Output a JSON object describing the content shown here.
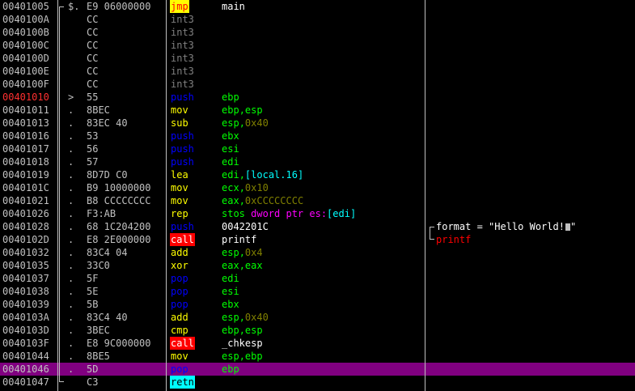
{
  "colors": {
    "background": "#000000",
    "text": "#c0c0c0",
    "white": "#ffffff",
    "mnemonic_default": "#ffff00",
    "int3": "#808080",
    "push_pop": "#0000ff",
    "call_bg": "#ff0000",
    "call_text": "#ffffff",
    "jmp_bg": "#ffff00",
    "jmp_text": "#ff0000",
    "retn_bg": "#00ffff",
    "retn_text": "#000000",
    "register": "#00ff00",
    "number": "#808000",
    "memref": "#00ffff",
    "keyword": "#ff00ff",
    "comment_red": "#ff0000",
    "selection": "#800080",
    "addr_current": "#ff3030"
  },
  "disassembly": [
    {
      "addr": "00401005",
      "mark": "$.",
      "hex": "E9 06000000",
      "mnemonic": "jmp",
      "ops": [
        [
          "main",
          "white"
        ]
      ]
    },
    {
      "addr": "0040100A",
      "mark": "",
      "hex": "CC",
      "mnemonic": "int3",
      "ops": []
    },
    {
      "addr": "0040100B",
      "mark": "",
      "hex": "CC",
      "mnemonic": "int3",
      "ops": []
    },
    {
      "addr": "0040100C",
      "mark": "",
      "hex": "CC",
      "mnemonic": "int3",
      "ops": []
    },
    {
      "addr": "0040100D",
      "mark": "",
      "hex": "CC",
      "mnemonic": "int3",
      "ops": []
    },
    {
      "addr": "0040100E",
      "mark": "",
      "hex": "CC",
      "mnemonic": "int3",
      "ops": []
    },
    {
      "addr": "0040100F",
      "mark": "",
      "hex": "CC",
      "mnemonic": "int3",
      "ops": []
    },
    {
      "addr": "00401010",
      "mark": ">",
      "hex": "55",
      "mnemonic": "push",
      "ops": [
        [
          "ebp",
          "register"
        ]
      ]
    },
    {
      "addr": "00401011",
      "mark": ".",
      "hex": "8BEC",
      "mnemonic": "mov",
      "ops": [
        [
          "ebp",
          "register"
        ],
        [
          ",",
          "register"
        ],
        [
          "esp",
          "register"
        ]
      ]
    },
    {
      "addr": "00401013",
      "mark": ".",
      "hex": "83EC 40",
      "mnemonic": "sub",
      "ops": [
        [
          "esp",
          "register"
        ],
        [
          ",",
          "register"
        ],
        [
          "0x40",
          "number"
        ]
      ]
    },
    {
      "addr": "00401016",
      "mark": ".",
      "hex": "53",
      "mnemonic": "push",
      "ops": [
        [
          "ebx",
          "register"
        ]
      ]
    },
    {
      "addr": "00401017",
      "mark": ".",
      "hex": "56",
      "mnemonic": "push",
      "ops": [
        [
          "esi",
          "register"
        ]
      ]
    },
    {
      "addr": "00401018",
      "mark": ".",
      "hex": "57",
      "mnemonic": "push",
      "ops": [
        [
          "edi",
          "register"
        ]
      ]
    },
    {
      "addr": "00401019",
      "mark": ".",
      "hex": "8D7D C0",
      "mnemonic": "lea",
      "ops": [
        [
          "edi",
          "register"
        ],
        [
          ",",
          "register"
        ],
        [
          "[local.16]",
          "memref"
        ]
      ]
    },
    {
      "addr": "0040101C",
      "mark": ".",
      "hex": "B9 10000000",
      "mnemonic": "mov",
      "ops": [
        [
          "ecx",
          "register"
        ],
        [
          ",",
          "register"
        ],
        [
          "0x10",
          "number"
        ]
      ]
    },
    {
      "addr": "00401021",
      "mark": ".",
      "hex": "B8 CCCCCCCC",
      "mnemonic": "mov",
      "ops": [
        [
          "eax",
          "register"
        ],
        [
          ",",
          "register"
        ],
        [
          "0xCCCCCCCC",
          "number"
        ]
      ]
    },
    {
      "addr": "00401026",
      "mark": ".",
      "hex": "F3:AB",
      "mnemonic": "rep",
      "ops": [
        [
          "stos ",
          "register"
        ],
        [
          "dword ptr es:",
          "keyword"
        ],
        [
          "[edi]",
          "memref"
        ]
      ]
    },
    {
      "addr": "00401028",
      "mark": ".",
      "hex": "68 1C204200",
      "mnemonic": "push",
      "ops": [
        [
          "0042201C",
          "white"
        ]
      ]
    },
    {
      "addr": "0040102D",
      "mark": ".",
      "hex": "E8 2E000000",
      "mnemonic": "call",
      "ops": [
        [
          "printf",
          "white"
        ]
      ]
    },
    {
      "addr": "00401032",
      "mark": ".",
      "hex": "83C4 04",
      "mnemonic": "add",
      "ops": [
        [
          "esp",
          "register"
        ],
        [
          ",",
          "register"
        ],
        [
          "0x4",
          "number"
        ]
      ]
    },
    {
      "addr": "00401035",
      "mark": ".",
      "hex": "33C0",
      "mnemonic": "xor",
      "ops": [
        [
          "eax",
          "register"
        ],
        [
          ",",
          "register"
        ],
        [
          "eax",
          "register"
        ]
      ]
    },
    {
      "addr": "00401037",
      "mark": ".",
      "hex": "5F",
      "mnemonic": "pop",
      "ops": [
        [
          "edi",
          "register"
        ]
      ]
    },
    {
      "addr": "00401038",
      "mark": ".",
      "hex": "5E",
      "mnemonic": "pop",
      "ops": [
        [
          "esi",
          "register"
        ]
      ]
    },
    {
      "addr": "00401039",
      "mark": ".",
      "hex": "5B",
      "mnemonic": "pop",
      "ops": [
        [
          "ebx",
          "register"
        ]
      ]
    },
    {
      "addr": "0040103A",
      "mark": ".",
      "hex": "83C4 40",
      "mnemonic": "add",
      "ops": [
        [
          "esp",
          "register"
        ],
        [
          ",",
          "register"
        ],
        [
          "0x40",
          "number"
        ]
      ]
    },
    {
      "addr": "0040103D",
      "mark": ".",
      "hex": "3BEC",
      "mnemonic": "cmp",
      "ops": [
        [
          "ebp",
          "register"
        ],
        [
          ",",
          "register"
        ],
        [
          "esp",
          "register"
        ]
      ]
    },
    {
      "addr": "0040103F",
      "mark": ".",
      "hex": "E8 9C000000",
      "mnemonic": "call",
      "ops": [
        [
          "_chkesp",
          "white"
        ]
      ]
    },
    {
      "addr": "00401044",
      "mark": ".",
      "hex": "8BE5",
      "mnemonic": "mov",
      "ops": [
        [
          "esp",
          "register"
        ],
        [
          ",",
          "register"
        ],
        [
          "ebp",
          "register"
        ]
      ]
    },
    {
      "addr": "00401046",
      "mark": ".",
      "hex": "5D",
      "mnemonic": "pop",
      "ops": [
        [
          "ebp",
          "register"
        ]
      ],
      "selected": true
    },
    {
      "addr": "00401047",
      "mark": "",
      "hex": "C3",
      "mnemonic": "retn",
      "ops": []
    }
  ],
  "comments": [
    {
      "row": 17,
      "text": "format = \"Hello World!",
      "color": "white",
      "cursor": true
    },
    {
      "row": 18,
      "text": "printf",
      "color": "comment_red"
    }
  ]
}
